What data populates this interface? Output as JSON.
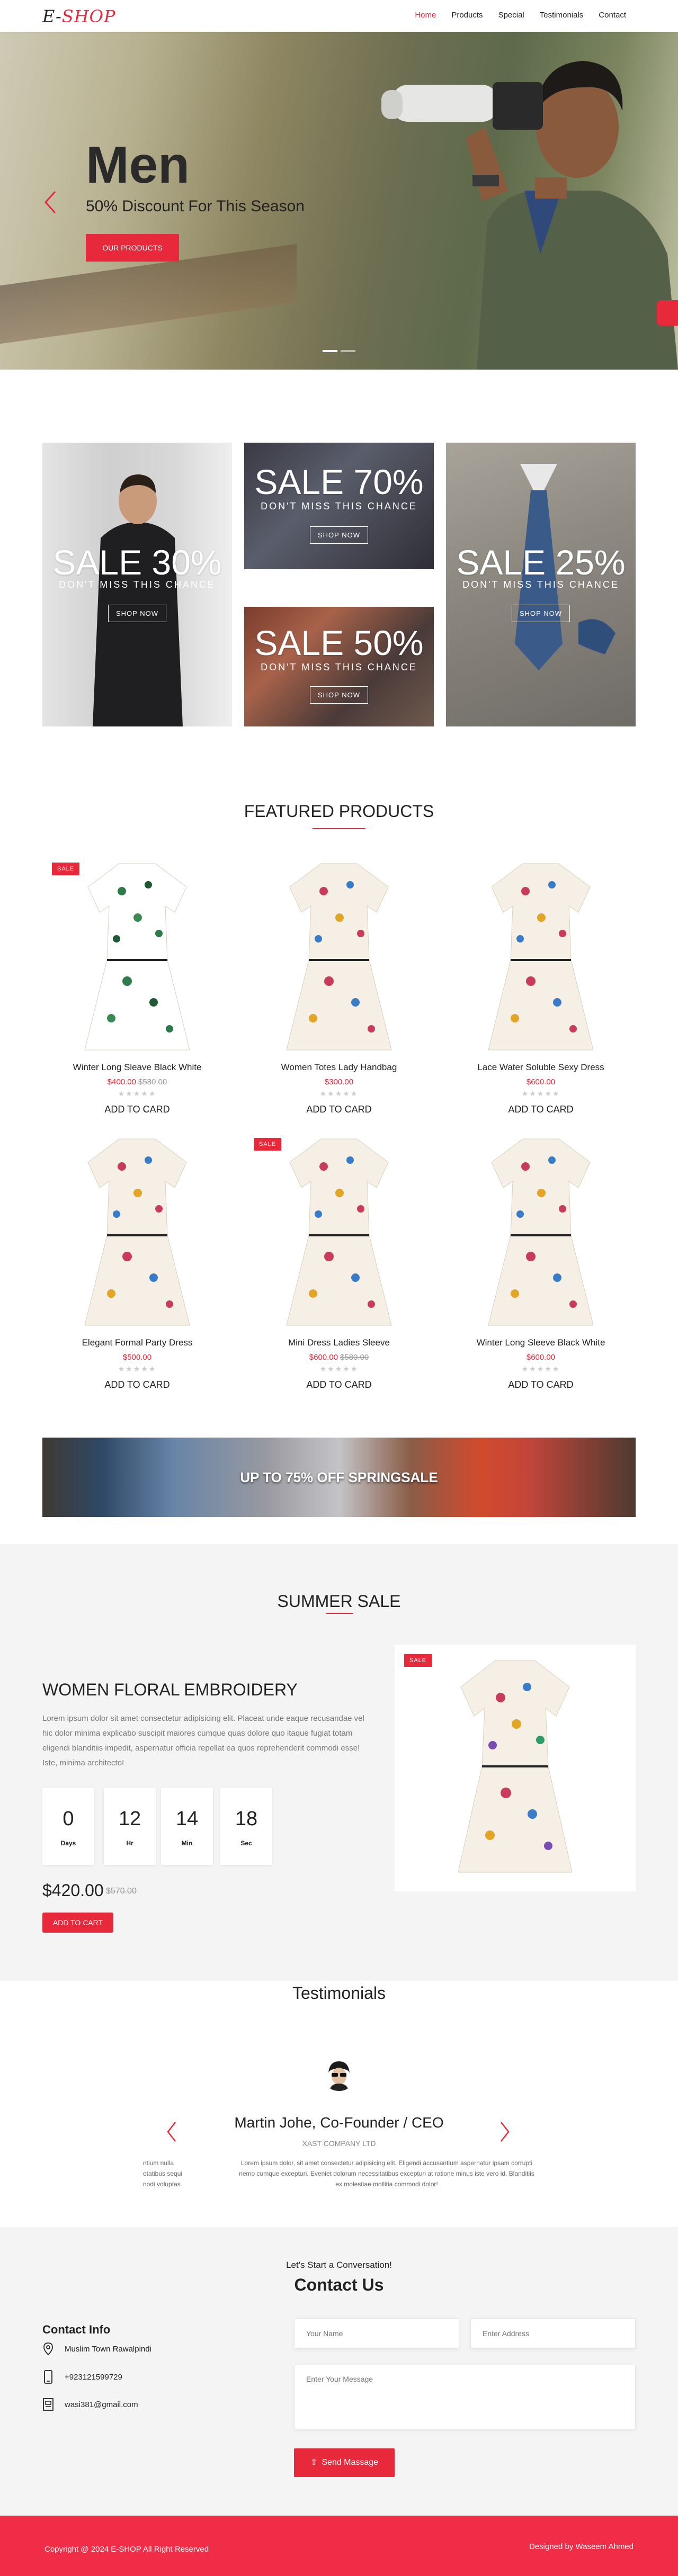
{
  "nav": {
    "logo_prefix": "E-",
    "logo_accent": "SHOP",
    "links": [
      "Home",
      "Products",
      "Special",
      "Testimonials",
      "Contact"
    ],
    "active": "Home"
  },
  "hero": {
    "title": "Men",
    "subtitle": "50% Discount For This Season",
    "button": "OUR PRODUCTS"
  },
  "promos": [
    {
      "big": "SALE 30%",
      "small": "DON'T MISS THIS CHANCE",
      "button": "SHOP NOW"
    },
    {
      "big": "SALE 70%",
      "small": "DON'T MISS THIS CHANCE",
      "button": "SHOP NOW"
    },
    {
      "big": "SALE 50%",
      "small": "DON'T MISS THIS CHANCE",
      "button": "SHOP NOW"
    },
    {
      "big": "SALE 25%",
      "small": "DON'T MISS THIS CHANCE",
      "button": "SHOP NOW"
    }
  ],
  "featured": {
    "title": "FEATURED PRODUCTS",
    "products": [
      {
        "name": "Winter Long Sleave Black White",
        "price": "$400.00",
        "old_price": "$580.00",
        "badge": "SALE",
        "stars": "★★★★★",
        "action": "ADD TO CARD"
      },
      {
        "name": "Women Totes Lady Handbag",
        "price": "$300.00",
        "old_price": "",
        "badge": "",
        "stars": "★★★★★",
        "action": "ADD TO CARD"
      },
      {
        "name": "Lace Water Soluble Sexy Dress",
        "price": "$600.00",
        "old_price": "",
        "badge": "",
        "stars": "★★★★★",
        "action": "ADD TO CARD"
      },
      {
        "name": "Elegant Formal Party Dress",
        "price": "$500.00",
        "old_price": "",
        "badge": "",
        "stars": "★★★★★",
        "action": "ADD TO CARD"
      },
      {
        "name": "Mini Dress Ladies Sleeve",
        "price": "$600.00",
        "old_price": "$580.00",
        "badge": "SALE",
        "stars": "★★★★★",
        "action": "ADD TO CARD"
      },
      {
        "name": "Winter Long Sleeve Black White",
        "price": "$600.00",
        "old_price": "",
        "badge": "",
        "stars": "★★★★★",
        "action": "ADD TO CARD"
      }
    ]
  },
  "banner": {
    "text": "UP TO 75% OFF SPRINGSALE"
  },
  "summer": {
    "title": "SUMMER SALE",
    "heading": "WOMEN FLORAL EMBROIDERY",
    "description": "Lorem ipsum dolor sit amet consectetur adipisicing elit. Placeat unde eaque recusandae vel hic dolor minima explicabo suscipit maiores cumque quas dolore quo itaque fugiat totam eligendi blanditiis impedit, aspernatur officia repellat ea quos reprehenderit commodi esse! Iste, minima architecto!",
    "countdown": [
      {
        "value": "0",
        "label": "Days"
      },
      {
        "value": "12",
        "label": "Hr"
      },
      {
        "value": "14",
        "label": "Min"
      },
      {
        "value": "18",
        "label": "Sec"
      }
    ],
    "price": "$420.00",
    "old_price": "$570.00",
    "button": "ADD TO CART",
    "badge": "SALE"
  },
  "testimonials": {
    "title": "Testimonials",
    "name": "Martin Johe, Co-Founder / CEO",
    "role": "XAST COMPANY LTD",
    "quote": "Lorem ipsum dolor, sit amet consectetur adipisicing elit. Eligendi accusantium aspernatur ipsam corrupti nemo cumque excepturi. Eveniet dolorum necessitatibus excepturi at ratione minus iste vero id. Blanditiis ex molestiae mollitia commodi dolor!",
    "prev_quote": "ntium nulla otatibus sequi nodi voluptas"
  },
  "contact": {
    "kicker": "Let's Start a Conversation!",
    "title": "Contact Us",
    "info_title": "Contact Info",
    "address": "Muslim Town Rawalpindi",
    "phone": "+923121599729",
    "email": "wasi381@gmail.com",
    "name_placeholder": "Your Name",
    "address_placeholder": "Enter Address",
    "message_placeholder": "Enter Your Message",
    "send": "Send Massage"
  },
  "footer": {
    "copyright": "Copyright @ 2024 E-SHOP All Right Reserved",
    "credit": "Designed by Waseem Ahmed"
  },
  "colors": {
    "accent": "#e8283b",
    "footer": "#f12c46",
    "section_bg": "#f4f4f4"
  }
}
